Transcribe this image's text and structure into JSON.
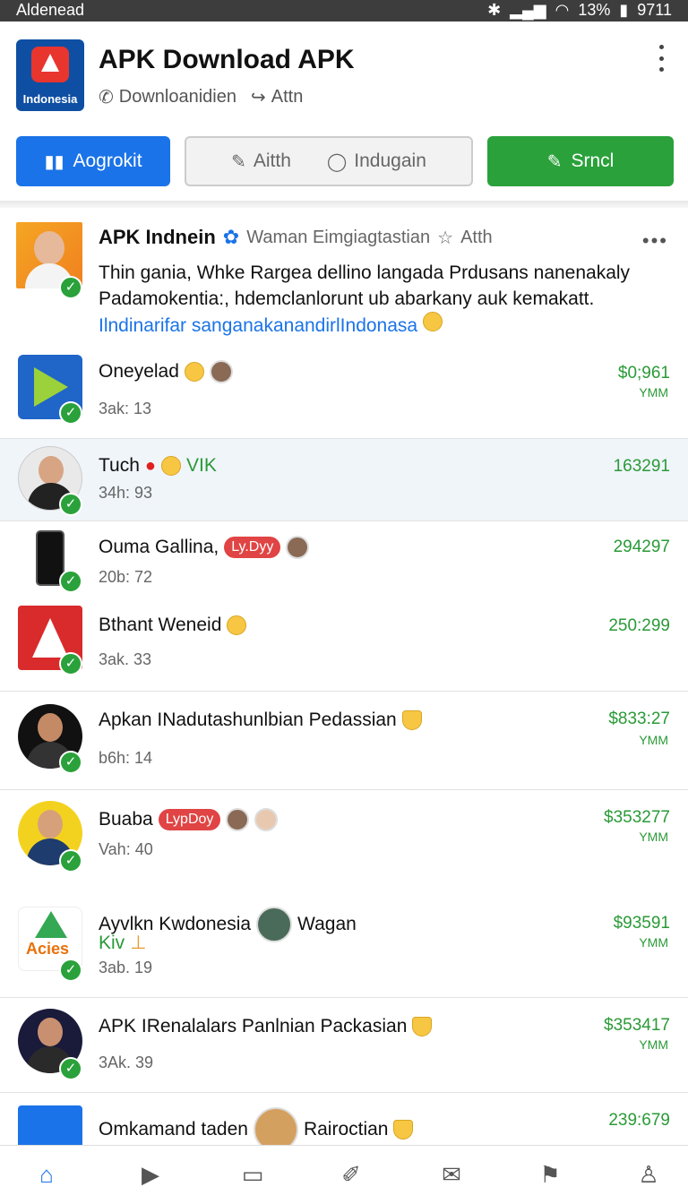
{
  "status": {
    "carrier": "Aldenead",
    "battery": "13%",
    "time": "9711"
  },
  "header": {
    "logo_caption": "Indonesia",
    "title": "APK Download APK",
    "sub_primary": "Downloanidien",
    "sub_secondary": "Attn"
  },
  "buttons": {
    "primary": "Aogrokit",
    "grey_left": "Aitth",
    "grey_right": "Indugain",
    "green": "Srncl"
  },
  "post": {
    "name": "APK Indnein",
    "meta_text": "Waman Eimgiagtastian",
    "meta_action": "Atth",
    "more": "•••",
    "body": "Thin gania, Whke Rargea dellino langada Prdusans nanenakaly Padamokentia:, hdemclanlorunt ub abarkany auk kemakatt.",
    "link": "Ilndinarifar sanganakanandirlIndonasa"
  },
  "rows": [
    {
      "title": "Oneyelad",
      "sub": "3ak: 13",
      "value": "$0;961",
      "currency": "YMM"
    },
    {
      "title": "Tuch",
      "tag": "VIK",
      "sub": "34h: 93",
      "value": "163291",
      "currency": ""
    },
    {
      "title": "Ouma Gallina,",
      "badge": "Ly.Dyy",
      "sub": "20b: 72",
      "value": "294297",
      "currency": ""
    },
    {
      "title": "Bthant Weneid",
      "sub": "3ak. 33",
      "value": "250:299",
      "currency": ""
    },
    {
      "title": "Apkan INadutashunlbian Pedassian",
      "sub": "b6h: 14",
      "value": "$833:27",
      "currency": "YMM"
    },
    {
      "title": "Buaba",
      "badge": "LypDoy",
      "sub": "Vah: 40",
      "value": "$353277",
      "currency": "YMM"
    },
    {
      "title": "Ayvlkn Kwdonesia",
      "title2": "Wagan",
      "tag": "Kiv",
      "logo_text": "Acies",
      "sub": "3ab. 19",
      "value": "$93591",
      "currency": "YMM"
    },
    {
      "title": "APK IRenalalars Panlnian Packasian",
      "sub": "3Ak. 39",
      "value": "$353417",
      "currency": "YMM"
    },
    {
      "title": "Omkamand taden",
      "title2": "Rairoctian",
      "sub": "",
      "value": "239:679",
      "currency": ""
    }
  ],
  "nav": [
    "home-icon",
    "play-icon",
    "screen-icon",
    "notes-icon",
    "inbox-icon",
    "flag-icon",
    "profile-icon"
  ],
  "colors": {
    "accent": "#1a73e8",
    "green": "#2aa13a",
    "badge": "#e04444"
  }
}
